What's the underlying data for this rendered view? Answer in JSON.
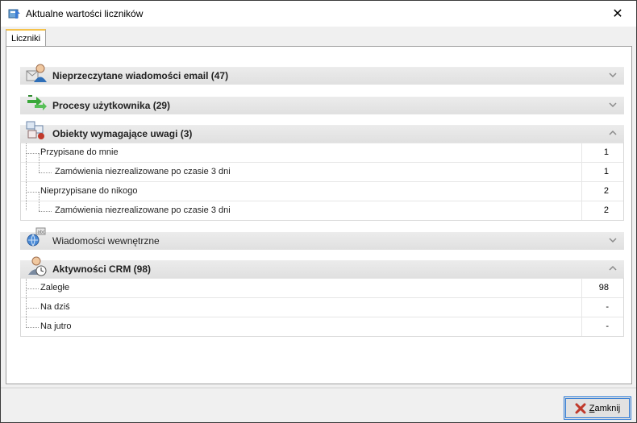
{
  "window": {
    "title": "Aktualne wartości liczników"
  },
  "tabs": [
    {
      "label": "Liczniki"
    }
  ],
  "sections": [
    {
      "title": "Nieprzeczytane wiadomości email (47)",
      "collapsed": true,
      "icon": "user-email-icon"
    },
    {
      "title": "Procesy użytkownika (29)",
      "collapsed": true,
      "icon": "process-arrows-icon"
    },
    {
      "title": "Obiekty wymagające uwagi (3)",
      "collapsed": false,
      "icon": "attention-objects-icon",
      "rows": [
        {
          "label": "Przypisane do mnie",
          "value": "1"
        },
        {
          "label": "Zamówienia niezrealizowane po czasie 3 dni",
          "value": "1"
        },
        {
          "label": "Nieprzypisane do nikogo",
          "value": "2"
        },
        {
          "label": "Zamówienia niezrealizowane po czasie 3 dni",
          "value": "2"
        }
      ]
    },
    {
      "title": "Wiadomości wewnętrzne",
      "collapsed": true,
      "icon": "internal-messages-icon"
    },
    {
      "title": "Aktywności CRM (98)",
      "collapsed": false,
      "icon": "crm-activities-icon",
      "rows": [
        {
          "label": "Zaległe",
          "value": "98"
        },
        {
          "label": "Na dziś",
          "value": "-"
        },
        {
          "label": "Na jutro",
          "value": "-"
        }
      ]
    }
  ],
  "footer": {
    "close_label": "Zamknij"
  },
  "colors": {
    "tab_accent": "#f5c24a",
    "button_focus": "#2f7bd6"
  }
}
